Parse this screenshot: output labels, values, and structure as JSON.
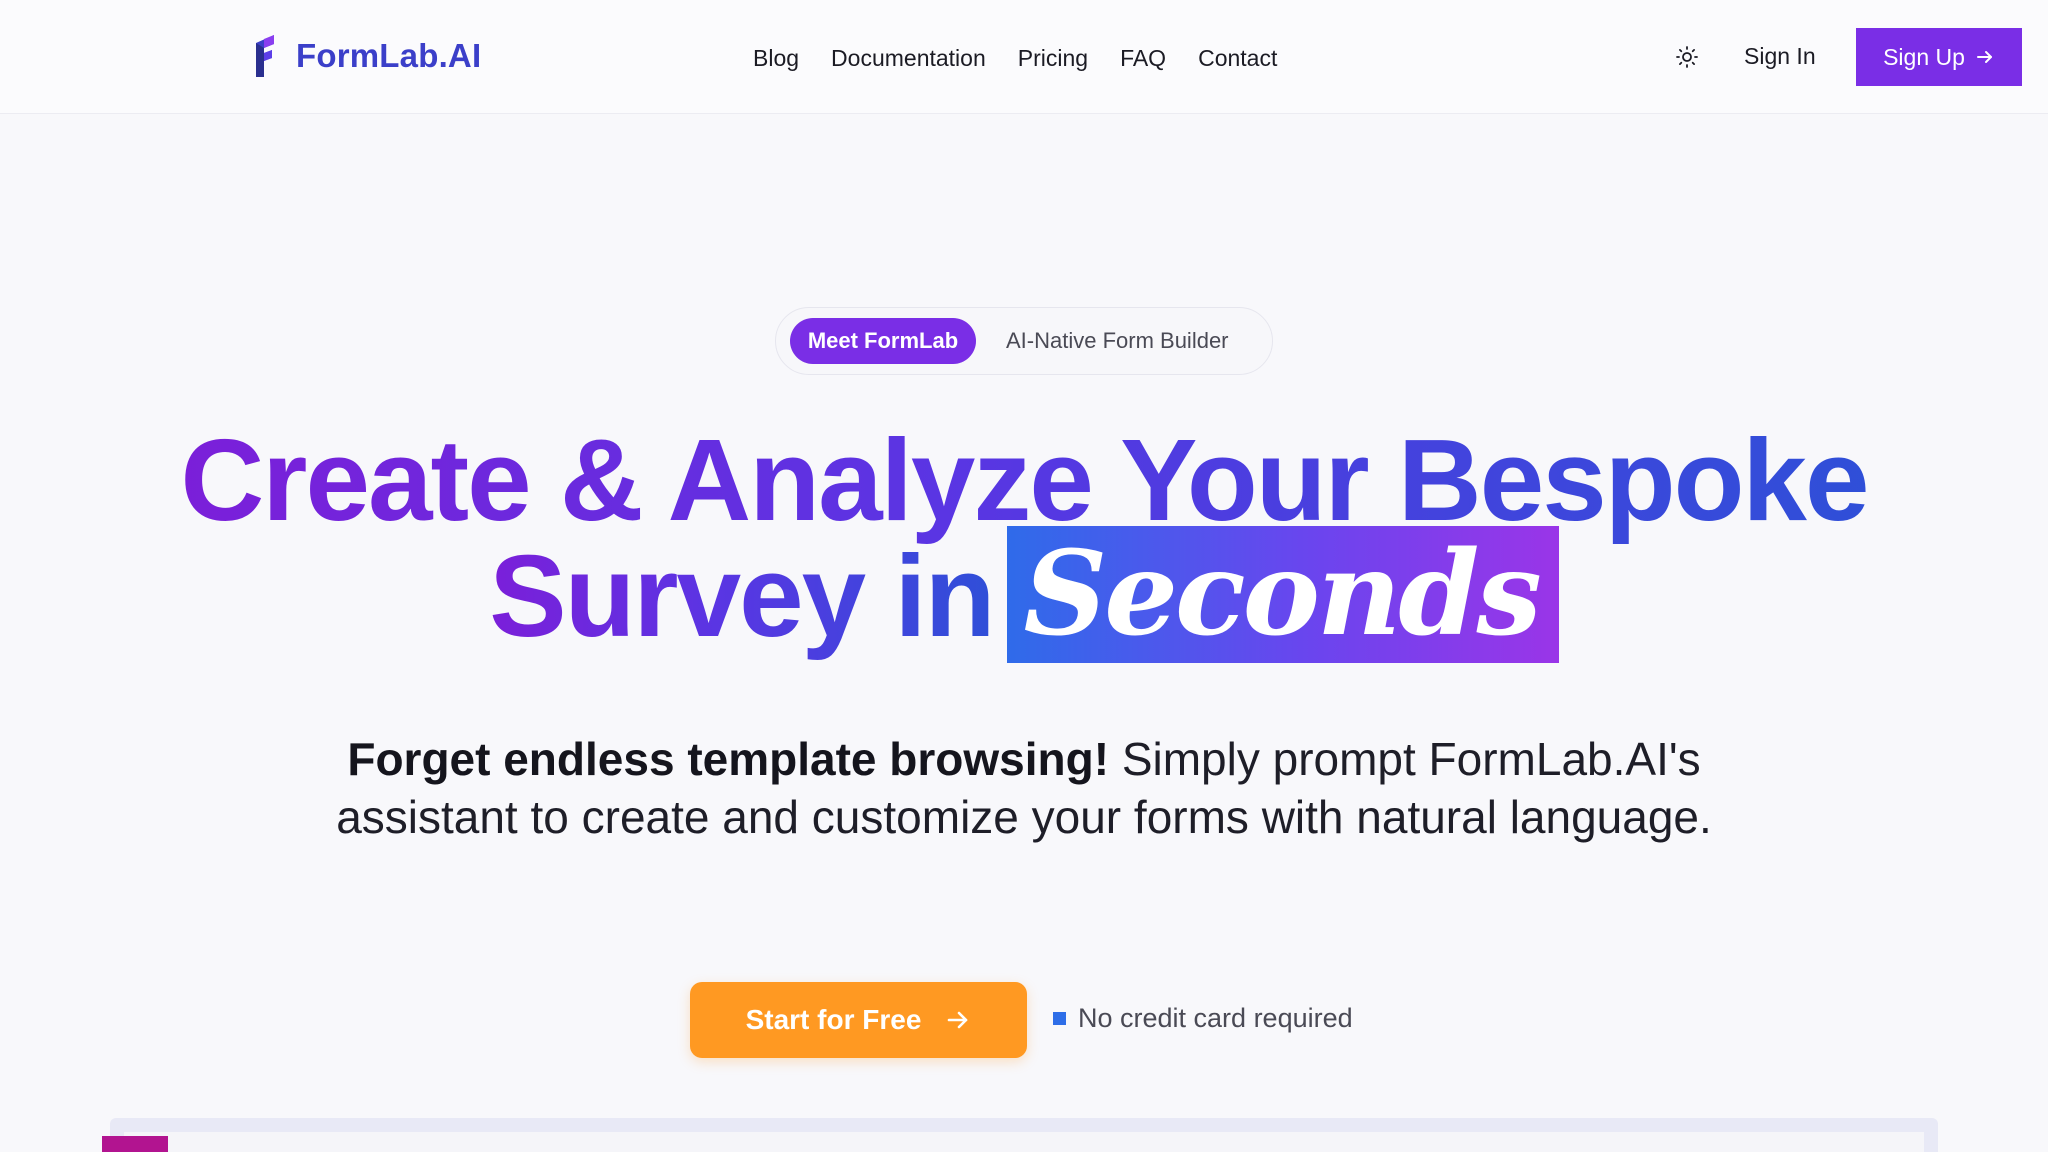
{
  "header": {
    "brand": "FormLab.AI",
    "nav": [
      {
        "label": "Blog"
      },
      {
        "label": "Documentation"
      },
      {
        "label": "Pricing"
      },
      {
        "label": "FAQ"
      },
      {
        "label": "Contact"
      }
    ],
    "theme_icon": "sun-icon",
    "signin_label": "Sign In",
    "signup_label": "Sign Up"
  },
  "hero": {
    "badge_pill": "Meet FormLab",
    "badge_text": "AI-Native Form Builder",
    "headline_line1": "Create & Analyze Your Bespoke",
    "headline_line2_prefix": "Survey in",
    "headline_highlight": "Seconds",
    "subtitle_bold": "Forget endless template browsing!",
    "subtitle_rest": "Simply prompt FormLab.AI's assistant to create and customize your forms with natural language.",
    "cta_label": "Start for Free",
    "no_cc": "No credit card required"
  },
  "colors": {
    "brand_purple": "#7a2ee6",
    "logo_blue": "#3b3fc9",
    "cta_orange": "#ff9922",
    "accent_blue": "#2e6ee8"
  }
}
